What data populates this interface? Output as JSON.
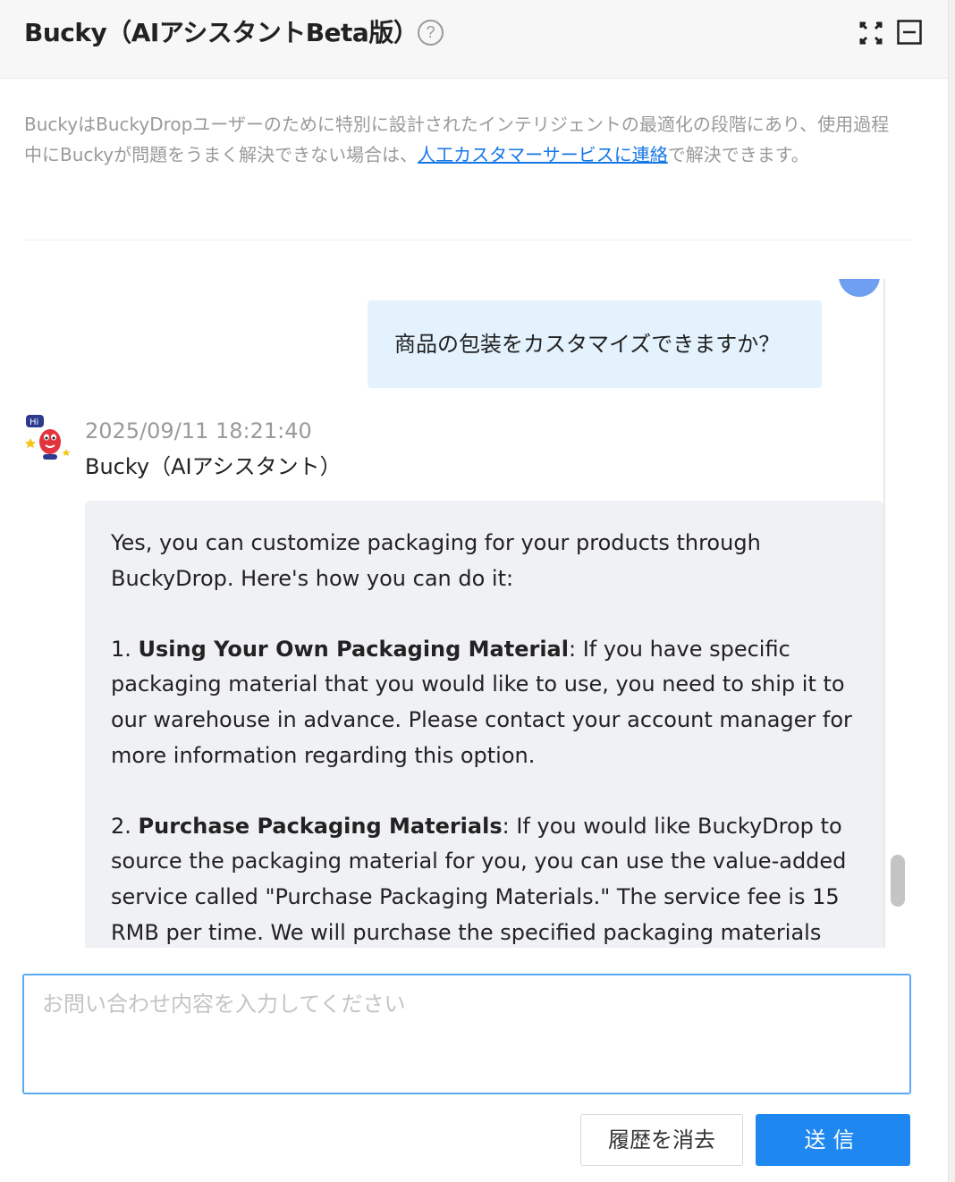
{
  "header": {
    "title": "Bucky（AIアシスタントBeta版）",
    "help_glyph": "?"
  },
  "notice": {
    "text_before": "BuckyはBuckyDropユーザーのために特別に設計されたインテリジェントの最適化の段階にあり、使用過程中にBuckyが問題をうまく解決できない場合は、",
    "link_text": "人工カスタマーサービスに連絡",
    "text_after": "で解決できます。"
  },
  "chat": {
    "user_message": "商品の包装をカスタマイズできますか？",
    "bot_timestamp": "2025/09/11 18:21:40",
    "bot_name": "Bucky（AIアシスタント）",
    "bot_reply": {
      "intro": "Yes, you can customize packaging for your products through BuckyDrop. Here's how you can do it:",
      "item1_number": "1. ",
      "item1_title": "Using Your Own Packaging Material",
      "item1_body": ": If you have specific packaging material that you would like to use, you need to ship it to our warehouse in advance. Please contact your account manager for more information regarding this option.",
      "item2_number": "2. ",
      "item2_title": "Purchase Packaging Materials",
      "item2_body": ": If you would like BuckyDrop to source the packaging material for you, you can use the value-added service called \"Purchase Packaging Materials.\" The service fee is 15 RMB per time. We will purchase the specified packaging materials from"
    }
  },
  "input": {
    "placeholder": "お問い合わせ内容を入力してください",
    "value": ""
  },
  "buttons": {
    "clear_label": "履歴を消去",
    "send_label": "送信"
  },
  "colors": {
    "accent": "#1e88f0",
    "link": "#1677e6",
    "user_bubble": "#e3f2fd",
    "bot_bubble": "#f0f1f4"
  },
  "icons": {
    "help": "question-circle-icon",
    "expand": "expand-icon",
    "minimize": "minimize-icon"
  }
}
